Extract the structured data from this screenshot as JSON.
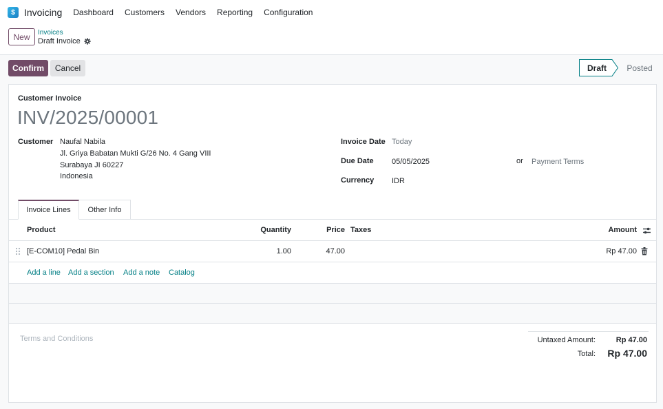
{
  "app": {
    "name": "Invoicing",
    "logo_letter": "$"
  },
  "nav": [
    "Dashboard",
    "Customers",
    "Vendors",
    "Reporting",
    "Configuration"
  ],
  "control": {
    "new_label": "New",
    "breadcrumb_parent": "Invoices",
    "breadcrumb_current": "Draft Invoice"
  },
  "actions": {
    "confirm": "Confirm",
    "cancel": "Cancel"
  },
  "status": {
    "draft": "Draft",
    "posted": "Posted",
    "active": "Draft"
  },
  "invoice": {
    "type": "Customer Invoice",
    "number": "INV/2025/00001",
    "customer_label": "Customer",
    "customer": {
      "name": "Naufal Nabila",
      "street": "Jl. Griya Babatan Mukti G/26 No. 4 Gang VIII",
      "city": "Surabaya JI 60227",
      "country": "Indonesia"
    },
    "invoice_date_label": "Invoice Date",
    "invoice_date": "Today",
    "due_date_label": "Due Date",
    "due_date": "05/05/2025",
    "or_label": "or",
    "payment_terms_placeholder": "Payment Terms",
    "currency_label": "Currency",
    "currency": "IDR"
  },
  "tabs": {
    "lines": "Invoice Lines",
    "other": "Other Info"
  },
  "lines": {
    "headers": {
      "product": "Product",
      "quantity": "Quantity",
      "price": "Price",
      "taxes": "Taxes",
      "amount": "Amount"
    },
    "rows": [
      {
        "product": "[E-COM10] Pedal Bin",
        "quantity": "1.00",
        "price": "47.00",
        "taxes": "",
        "amount": "Rp 47.00"
      }
    ],
    "add_line": "Add a line",
    "add_section": "Add a section",
    "add_note": "Add a note",
    "catalog": "Catalog"
  },
  "terms_placeholder": "Terms and Conditions",
  "totals": {
    "untaxed_label": "Untaxed Amount:",
    "untaxed": "Rp 47.00",
    "total_label": "Total:",
    "total": "Rp 47.00"
  },
  "colors": {
    "brand": "#714b67",
    "link": "#017e84",
    "status_active": "#017e84"
  }
}
